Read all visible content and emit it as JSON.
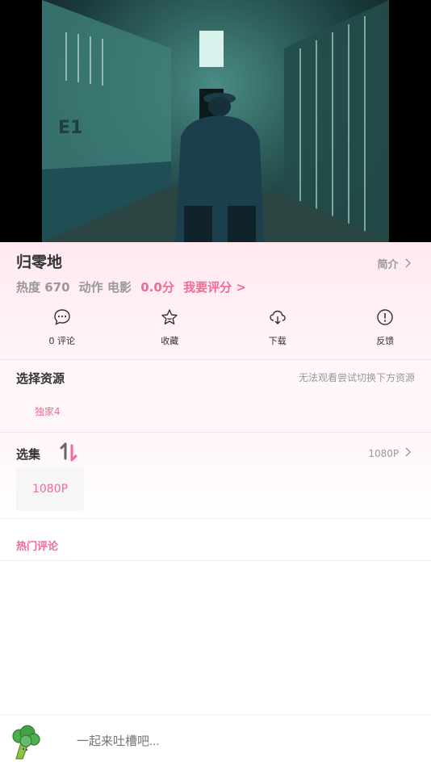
{
  "movie": {
    "title": "归零地",
    "intro_label": "简介",
    "heat_label": "热度 670",
    "genre": "动作 电影",
    "score": "0.0分",
    "rate_label": "我要评分 >"
  },
  "actions": [
    {
      "label": "0 评论",
      "icon": "comment-icon"
    },
    {
      "label": "收藏",
      "icon": "star-icon"
    },
    {
      "label": "下载",
      "icon": "cloud-download-icon"
    },
    {
      "label": "反馈",
      "icon": "exclamation-icon"
    }
  ],
  "resource": {
    "title": "选择资源",
    "hint": "无法观看尝试切换下方资源",
    "source": "独家4"
  },
  "episodes": {
    "title": "选集",
    "quality": "1080P",
    "items": [
      "1080P"
    ]
  },
  "hot_comments_label": "热门评论",
  "comment_box": {
    "placeholder": "一起来吐槽吧..."
  },
  "colors": {
    "accent": "#f36b93",
    "muted": "#999999"
  }
}
